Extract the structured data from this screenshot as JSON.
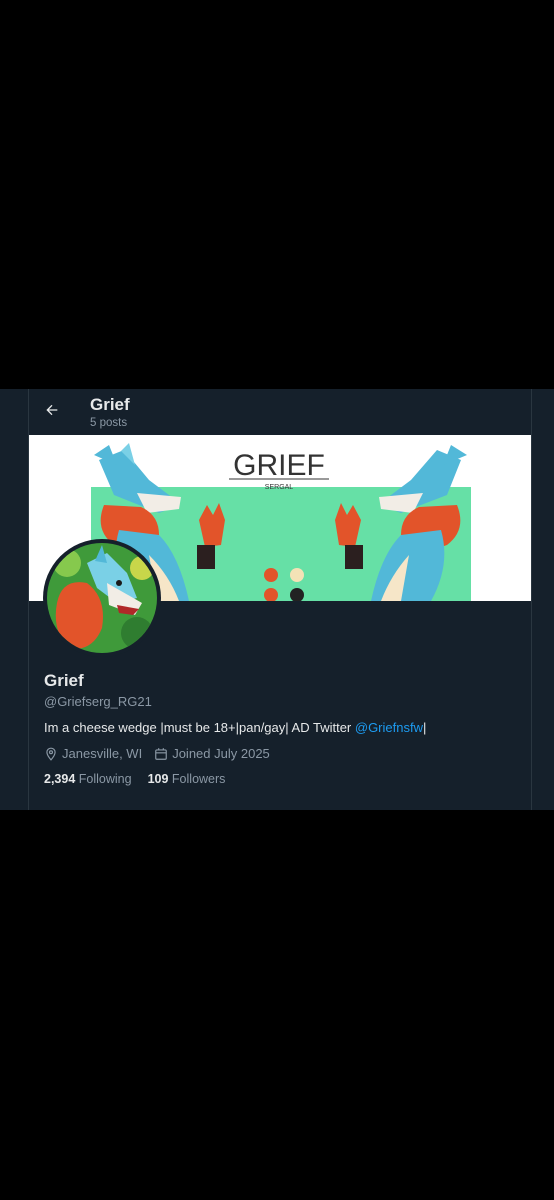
{
  "header": {
    "title": "Grief",
    "posts_count": "5 posts"
  },
  "banner": {
    "title_text": "GRIEF",
    "sub_text": "SERGAL"
  },
  "profile": {
    "name": "Grief",
    "handle": "@Griefserg_RG21",
    "bio_text": "Im a cheese wedge |must be 18+|pan/gay| AD Twitter ",
    "bio_link": "@Griefnsfw",
    "bio_tail": "|",
    "location": "Janesville, WI",
    "joined": "Joined July 2025",
    "following_count": "2,394",
    "following_label": "Following",
    "followers_count": "109",
    "followers_label": "Followers"
  },
  "colors": {
    "background": "#15202b",
    "text": "#e7e9ea",
    "muted": "#8b98a5",
    "link": "#1d9bf0"
  },
  "icons": [
    "back-arrow-icon",
    "location-icon",
    "calendar-icon"
  ]
}
